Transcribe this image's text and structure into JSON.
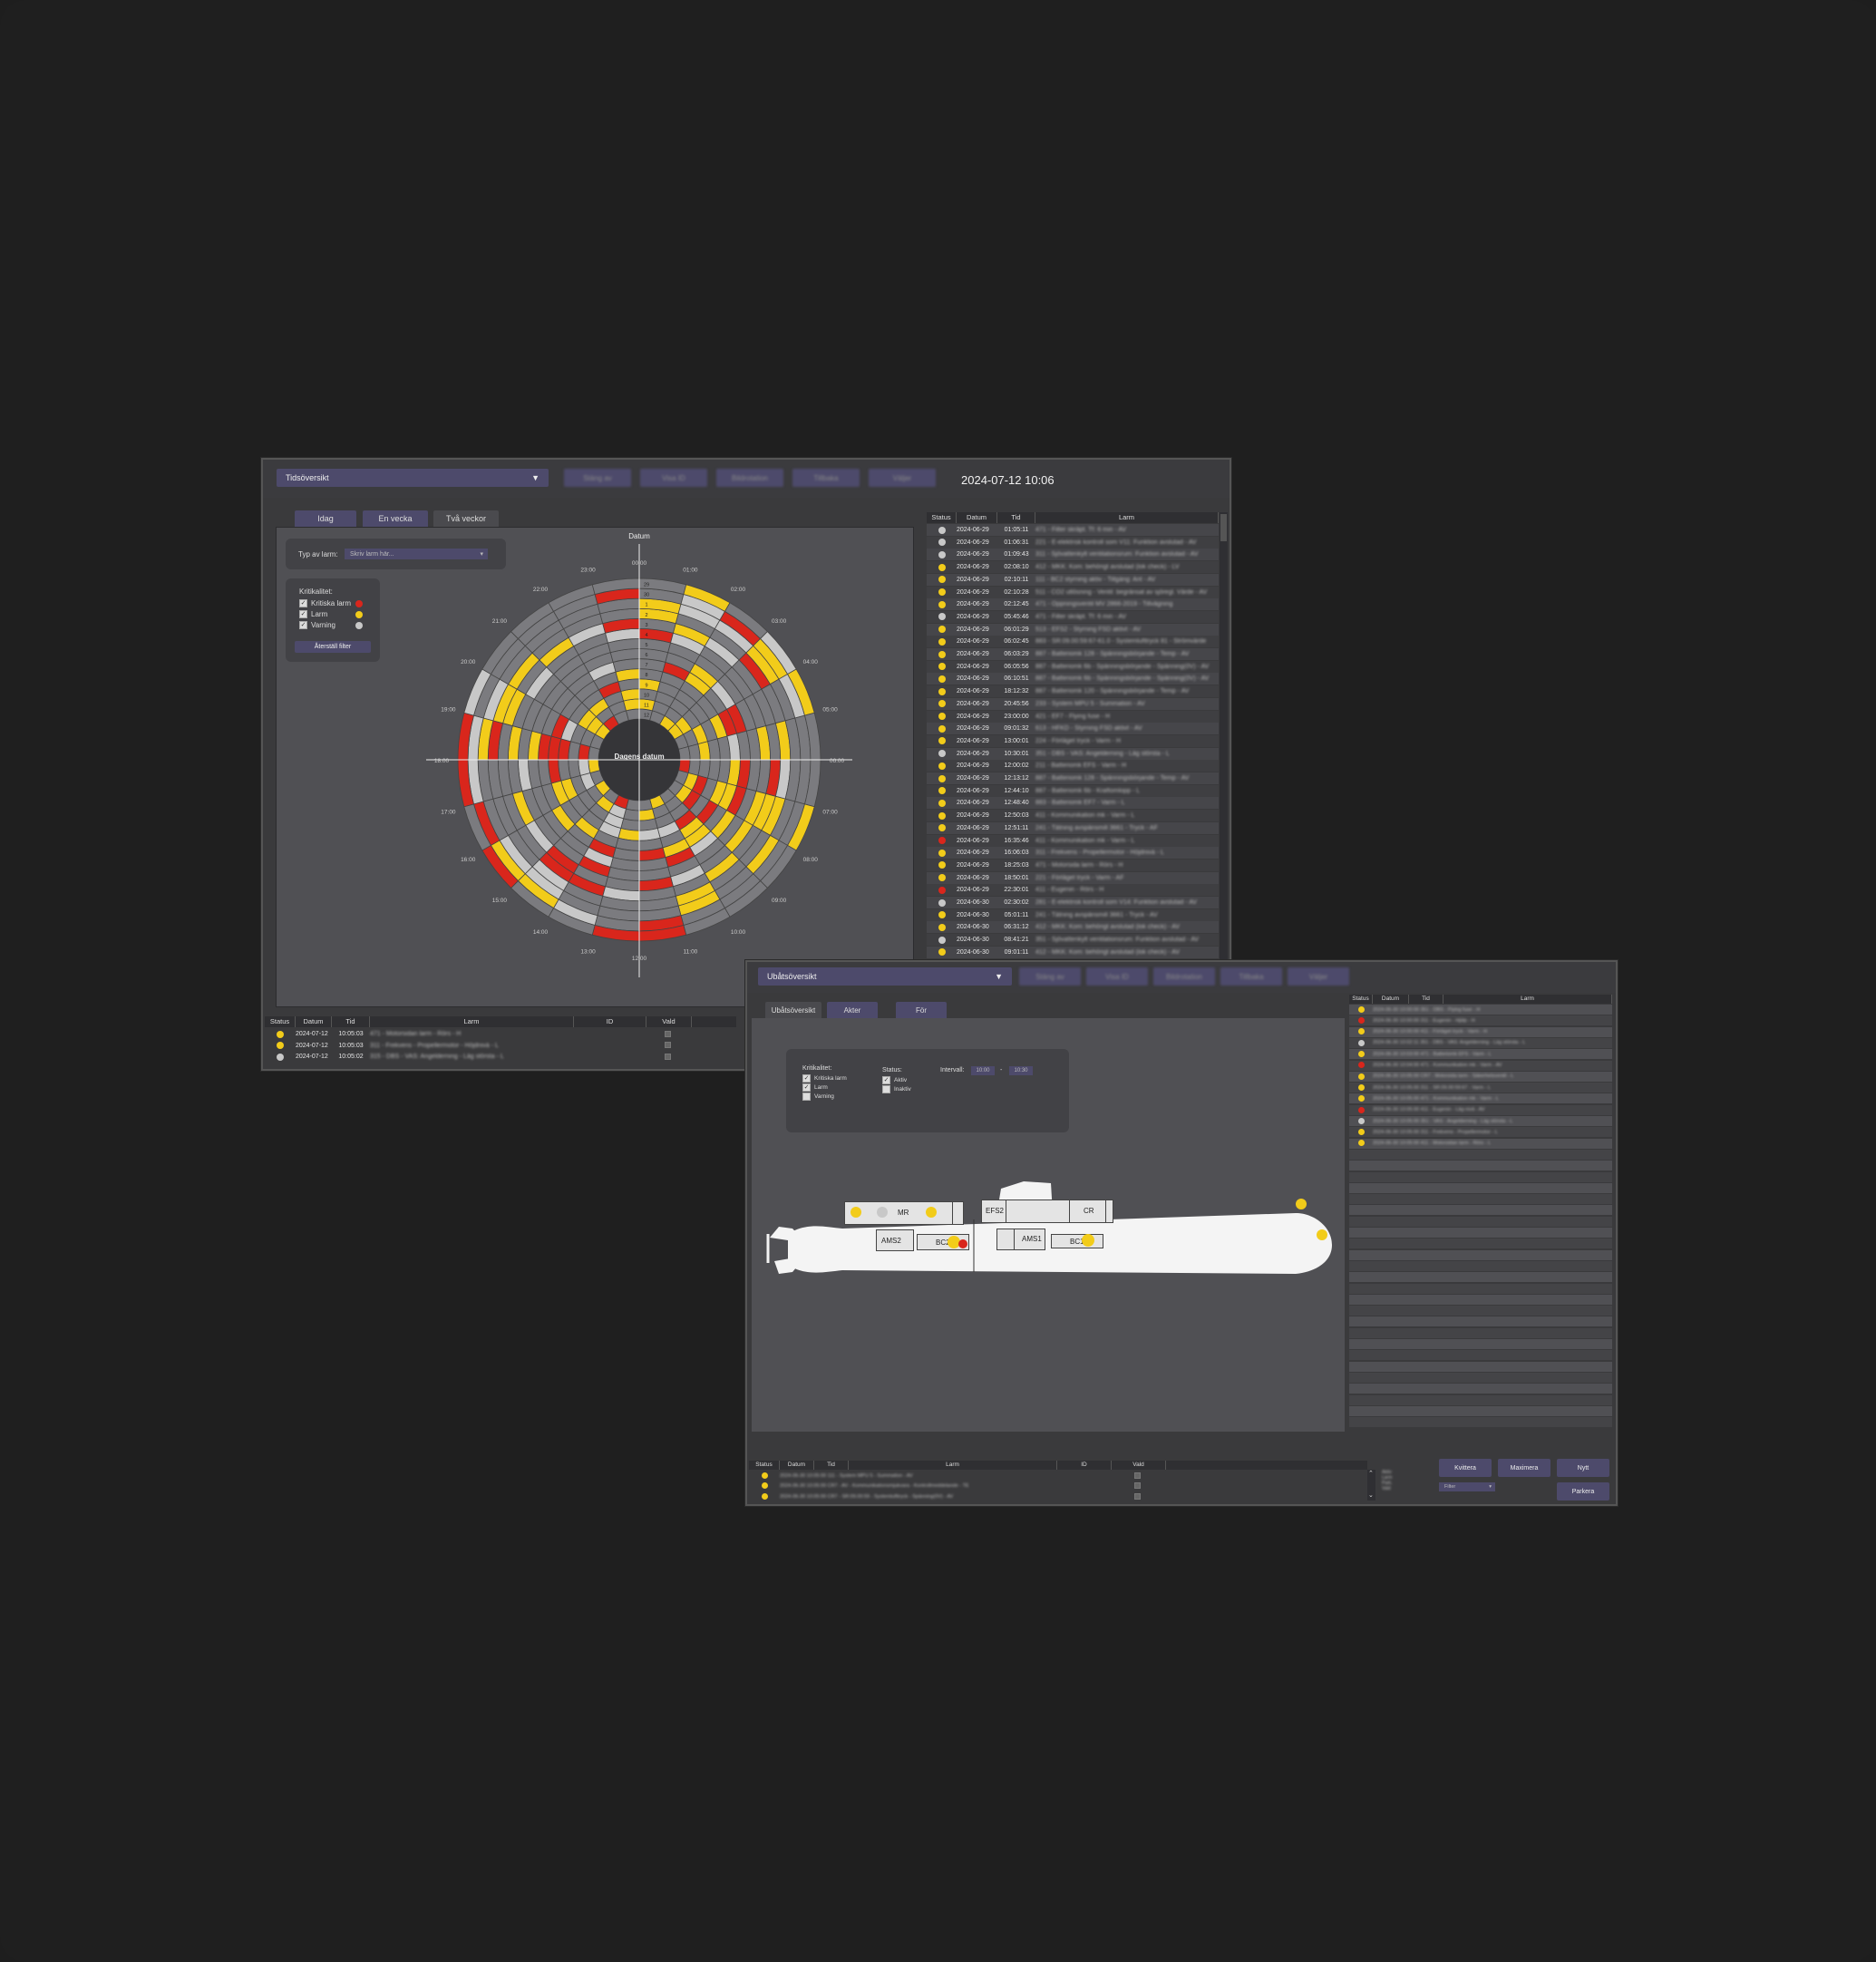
{
  "window1": {
    "view_select": "Tidsöversikt",
    "toolbar_buttons": [
      "Stäng av",
      "Visa ID",
      "Bildrotation",
      "Tillbaka",
      "Väljer"
    ],
    "datetime": "2024-07-12 10:06",
    "tabs": [
      "Idag",
      "En vecka",
      "Två veckor"
    ],
    "type_label": "Typ av larm:",
    "type_placeholder": "Skriv larm här...",
    "criticality_title": "Kritikalitet:",
    "criticality": [
      {
        "label": "Kritiska larm",
        "color": "#d9261c",
        "checked": true
      },
      {
        "label": "Larm",
        "color": "#f2cc1a",
        "checked": true
      },
      {
        "label": "Varning",
        "color": "#c8c8c8",
        "checked": true
      }
    ],
    "reset_button": "Återställ filter",
    "radial": {
      "top_label": "Datum",
      "center_label": "Dagens datum",
      "hours": [
        "00:00",
        "01:00",
        "02:00",
        "03:00",
        "04:00",
        "05:00",
        "06:00",
        "07:00",
        "08:00",
        "09:00",
        "10:00",
        "11:00",
        "12:00",
        "13:00",
        "14:00",
        "15:00",
        "16:00",
        "17:00",
        "18:00",
        "19:00",
        "20:00",
        "21:00",
        "22:00",
        "23:00"
      ],
      "day_numbers": [
        "29",
        "30",
        "1",
        "2",
        "3",
        "4",
        "5",
        "6",
        "7",
        "8",
        "9",
        "10",
        "11",
        "12"
      ]
    },
    "alarm_list": {
      "headers": [
        "Status",
        "Datum",
        "Tid",
        "Larm"
      ],
      "rows": [
        {
          "s": "g",
          "d": "2024-06-29",
          "t": "01:05:11",
          "l": "471 - Filter skräpt. Tf: 6 min - AV"
        },
        {
          "s": "g",
          "d": "2024-06-29",
          "t": "01:06:31",
          "l": "221 - E-elektrisk kontroll som V11: Funktion avslutad - AV"
        },
        {
          "s": "g",
          "d": "2024-06-29",
          "t": "01:09:43",
          "l": "311 - Sjövattenkylt ventilationsrum: Funktion avslutad - AV"
        },
        {
          "s": "y",
          "d": "2024-06-29",
          "t": "02:08:10",
          "l": "412 - MKK: Kom: behörigt avslutad (lok check) - LV"
        },
        {
          "s": "y",
          "d": "2024-06-29",
          "t": "02:10:11",
          "l": "111 - BC2 styrning aktiv - Tillgång: Ant - AV"
        },
        {
          "s": "y",
          "d": "2024-06-29",
          "t": "02:10:28",
          "l": "511 - CO2 utlösning - Ventil: begränsat av sjöregl. Värde - AV"
        },
        {
          "s": "y",
          "d": "2024-06-29",
          "t": "02:12:45",
          "l": "471 - Öppningsventil MV 2866-2019 - Tillvägning"
        },
        {
          "s": "g",
          "d": "2024-06-29",
          "t": "05:45:46",
          "l": "471 - Filter skräpt. Tf: 6 min - AV"
        },
        {
          "s": "y",
          "d": "2024-06-29",
          "t": "06:01:29",
          "l": "513 - EFS2 - Styrning FSD aktivt - AV"
        },
        {
          "s": "y",
          "d": "2024-06-29",
          "t": "06:02:45",
          "l": "883 - SR:09.00:59:67-61.0 - Systemlufttryck 81 - Strömvärde"
        },
        {
          "s": "y",
          "d": "2024-06-29",
          "t": "06:03:29",
          "l": "887 - Batteriomk 128 - Spänningsbörjande - Temp - AV"
        },
        {
          "s": "y",
          "d": "2024-06-29",
          "t": "06:05:56",
          "l": "887 - Batteriomk 6b - Spänningsbörjande - Spänning(0V) - AV"
        },
        {
          "s": "y",
          "d": "2024-06-29",
          "t": "06:10:51",
          "l": "887 - Batteriomk 6b - Spänningsbörjande - Spänning(0V) - AV"
        },
        {
          "s": "y",
          "d": "2024-06-29",
          "t": "18:12:32",
          "l": "887 - Batteriomk 120 - Spänningsbörjande - Temp - AV"
        },
        {
          "s": "y",
          "d": "2024-06-29",
          "t": "20:45:56",
          "l": "233 - System MPU 5 - Summation - AV"
        },
        {
          "s": "y",
          "d": "2024-06-29",
          "t": "23:00:00",
          "l": "421 - EF7 - Flying fuse - H"
        },
        {
          "s": "y",
          "d": "2024-06-29",
          "t": "09:01:32",
          "l": "613 - HFKD - Styrning FSD aktivt - AV"
        },
        {
          "s": "y",
          "d": "2024-06-29",
          "t": "13:00:01",
          "l": "224 - Förläget tryck - Varm - H"
        },
        {
          "s": "g",
          "d": "2024-06-29",
          "t": "10:30:01",
          "l": "351 - DBS - VAS: Angelderning - Läg största - L"
        },
        {
          "s": "y",
          "d": "2024-06-29",
          "t": "12:00:02",
          "l": "211 - Batteriomk EFS - Varm - H"
        },
        {
          "s": "y",
          "d": "2024-06-29",
          "t": "12:13:12",
          "l": "887 - Batteriomk 128 - Spänningsbörjande - Temp - AV"
        },
        {
          "s": "y",
          "d": "2024-06-29",
          "t": "12:44:10",
          "l": "887 - Batteriomk 6b - Kraftomlopp - L"
        },
        {
          "s": "y",
          "d": "2024-06-29",
          "t": "12:48:40",
          "l": "883 - Batteriomk EF7 - Varm - L"
        },
        {
          "s": "y",
          "d": "2024-06-29",
          "t": "12:50:03",
          "l": "411 - Kommunikation mk - Varm - L"
        },
        {
          "s": "y",
          "d": "2024-06-29",
          "t": "12:51:11",
          "l": "241 - Tätning avspänsmill 3661 - Tryck - AF"
        },
        {
          "s": "r",
          "d": "2024-06-29",
          "t": "16:35:46",
          "l": "411 - Kommunikation mk - Varm - L"
        },
        {
          "s": "y",
          "d": "2024-06-29",
          "t": "16:06:03",
          "l": "311 - Frekvens - Propellermotor - Höjdnivå - L"
        },
        {
          "s": "y",
          "d": "2024-06-29",
          "t": "18:25:03",
          "l": "471 - Motorsida larm - Rörs - H"
        },
        {
          "s": "y",
          "d": "2024-06-29",
          "t": "18:50:01",
          "l": "221 - Förläget tryck - Varm - AF"
        },
        {
          "s": "r",
          "d": "2024-06-29",
          "t": "22:30:01",
          "l": "411 - Eugenin - Rörs - H"
        },
        {
          "s": "g",
          "d": "2024-06-30",
          "t": "02:30:02",
          "l": "281 - E-elektrisk kontroll som V14: Funktion avslutad - AV"
        },
        {
          "s": "y",
          "d": "2024-06-30",
          "t": "05:01:11",
          "l": "241 - Tätning avspänsmill 3661 - Tryck - AV"
        },
        {
          "s": "y",
          "d": "2024-06-30",
          "t": "06:31:12",
          "l": "412 - MKK: Kom: behörigt avslutad (lok check) - AV"
        },
        {
          "s": "g",
          "d": "2024-06-30",
          "t": "08:41:21",
          "l": "351 - Sjövattenkylt ventilationsrum: Funktion avslutad - AV"
        },
        {
          "s": "y",
          "d": "2024-06-30",
          "t": "09:01:11",
          "l": "412 - MKK: Kom: behörigt avslutad (lok check) - AV"
        }
      ]
    },
    "bottom_table": {
      "headers": [
        "Status",
        "Datum",
        "Tid",
        "Larm",
        "ID",
        "Vald"
      ],
      "rows": [
        {
          "s": "y",
          "d": "2024-07-12",
          "t": "10:05:03",
          "l": "471 - Motorsidan larm - Rörs - H"
        },
        {
          "s": "y",
          "d": "2024-07-12",
          "t": "10:05:03",
          "l": "311 - Frekvens - Propellermotor - Höjdnivå - L"
        },
        {
          "s": "g",
          "d": "2024-07-12",
          "t": "10:05:02",
          "l": "315 - DBS - VAS: Angelderning - Läg största - L"
        }
      ]
    }
  },
  "window2": {
    "view_select": "Ubåtsöversikt",
    "toolbar_buttons": [
      "Stäng av",
      "Visa ID",
      "Bildrotation",
      "Tillbaka",
      "Väljer"
    ],
    "tabs": [
      "Ubåtsöversikt",
      "Akter",
      "För"
    ],
    "criticality_title": "Kritikalitet:",
    "criticality": [
      {
        "label": "Kritiska larm",
        "checked": true
      },
      {
        "label": "Larm",
        "checked": true
      },
      {
        "label": "Varning",
        "checked": false
      }
    ],
    "status_title": "Status:",
    "status": [
      {
        "label": "Aktiv",
        "checked": true
      },
      {
        "label": "Inaktiv",
        "checked": false
      }
    ],
    "interval_label": "Intervall:",
    "interval_from": "10:00",
    "interval_sep": "-",
    "interval_to": "10:30",
    "compartments": [
      "MR",
      "AMS2",
      "BC2",
      "EFS2",
      "CR",
      "AMS1",
      "BC1"
    ],
    "alarm_list": {
      "headers": [
        "Status",
        "Datum",
        "Tid",
        "Larm"
      ],
      "rows": [
        {
          "s": "y",
          "l": "2024-06-30  10:00:00   351 - DBS - Flying fuse - H"
        },
        {
          "s": "r",
          "l": "2024-06-30  10:00:00   311 - Eugenin - Hjälp - H"
        },
        {
          "s": "y",
          "l": "2024-06-30  10:00:00   411 - Förläget tryck - Varm - H"
        },
        {
          "s": "g",
          "l": "2024-06-30  10:02:11   351 - DBS - VAS: Angelderning - Läg största - L"
        },
        {
          "s": "y",
          "l": "2024-06-30  10:03:00   471 - Batteriomk EFS - Varm - L"
        },
        {
          "s": "r",
          "l": "2024-06-30  10:04:00   471 - Kommunikation mk - Varm - AV"
        },
        {
          "s": "y",
          "l": "2024-06-30  10:05:00   CR7 - Motorsida larm - Säkerhetsventil - L"
        },
        {
          "s": "y",
          "l": "2024-06-30  10:05:00   311 - SR:09.00:59:67 - Varm - L"
        },
        {
          "s": "y",
          "l": "2024-06-30  10:05:00   471 - Kommunikation mk - Varm - L"
        },
        {
          "s": "r",
          "l": "2024-06-30  10:05:00   411 - Eugenin - Låg nivå - AV"
        },
        {
          "s": "g",
          "l": "2024-06-30  10:05:00   351 - VAS - Angelderning - Läg största - L"
        },
        {
          "s": "y",
          "l": "2024-06-30  10:05:00   311 - Frekvens - Propellermotor - L"
        },
        {
          "s": "y",
          "l": "2024-06-30  10:05:00   411 - Motorsidan larm - Rörs - L"
        }
      ]
    },
    "bottom_table": {
      "headers": [
        "Status",
        "Datum",
        "Tid",
        "Larm",
        "ID",
        "Vald"
      ],
      "rows": [
        {
          "s": "y",
          "l": "2024-06-30  10:05:00   111 - System MPU 5 - Summation - AV"
        },
        {
          "s": "y",
          "l": "2024-06-30  10:05:00   CR7 - AV - Kommunikationsmjukvara - Kontrollmeddelande - TE"
        },
        {
          "s": "y",
          "l": "2024-06-30  10:05:00   CR7 - SR:09.00:59 - Systemlufttryck - Spänning(0V) - AV"
        }
      ]
    },
    "action_buttons": {
      "acknowledge": "Kvittera",
      "maximize": "Maximera",
      "new": "Nytt",
      "park": "Parkera"
    },
    "filter_select": "Filter",
    "side_stats": [
      "Aktiv",
      "Larm",
      "Park.",
      "Vald"
    ]
  },
  "colors": {
    "critical": "#d9261c",
    "alarm": "#f2cc1a",
    "warning": "#c8c8c8",
    "accent": "#4d4a6b"
  }
}
